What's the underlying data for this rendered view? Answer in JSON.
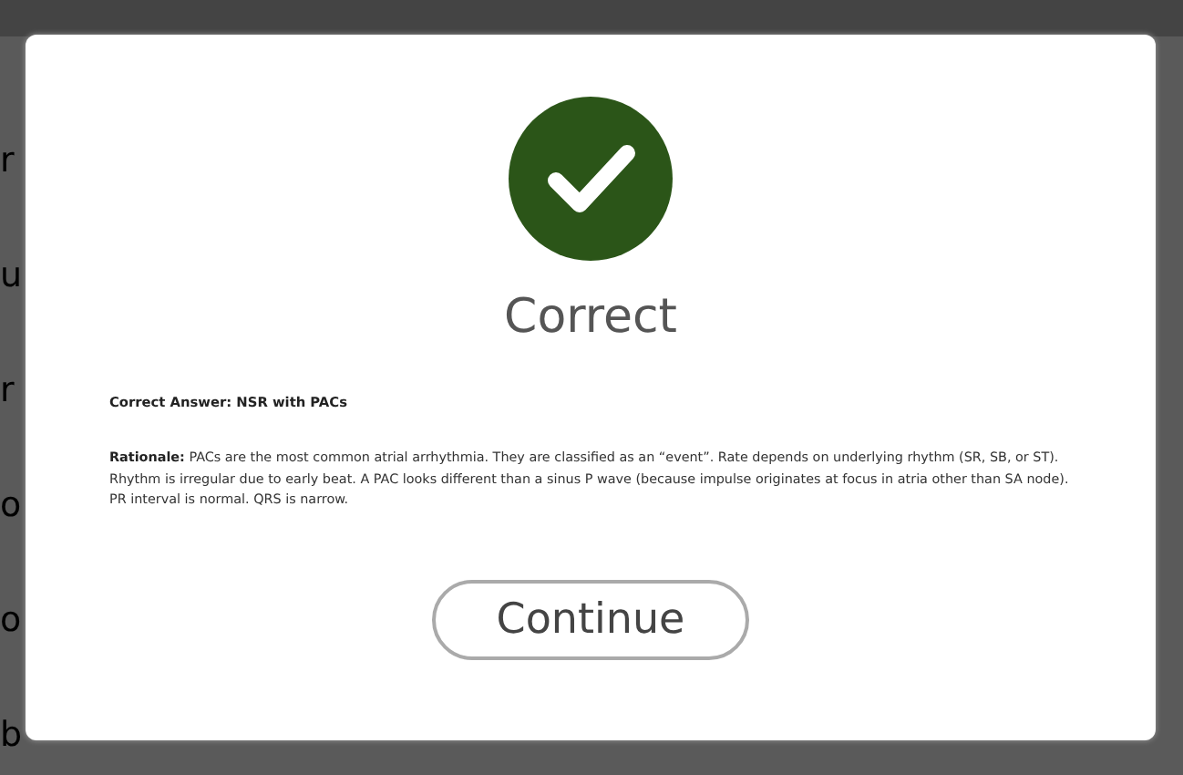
{
  "background_fragments": [
    "r",
    "u",
    "r",
    "o",
    "o",
    "b"
  ],
  "dialog": {
    "title": "Correct",
    "answer_label": "Correct Answer:",
    "answer": "NSR with PACs",
    "rationale": "**Rationale:**  PACs are the most common atrial arrhythmia. They are classified as an “event”. Rate depends on underlying rhythm (SR, SB, or ST). Rhythm is irregular due to early beat. A PAC looks different than a sinus P wave (because impulse originates at focus in atria other than SA node). PR interval is normal. QRS is narrow.",
    "button": "Continue"
  }
}
